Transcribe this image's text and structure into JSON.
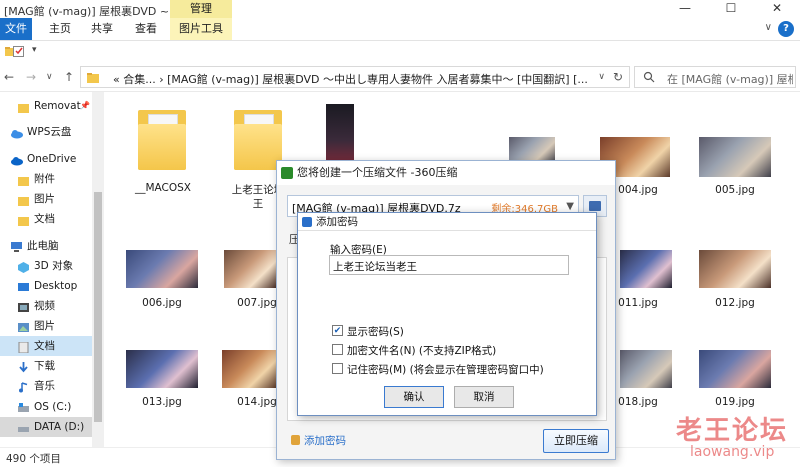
{
  "window": {
    "title": "[MAG館 (v-mag)] 屋根裏DVD ~...",
    "manage_tab": "管理",
    "minimize": "—",
    "maximize": "☐",
    "close": "✕"
  },
  "ribbon": {
    "tabs": [
      "文件",
      "主页",
      "共享",
      "查看",
      "图片工具"
    ],
    "help": "?"
  },
  "nav": {
    "back": "←",
    "forward": "→",
    "recent": "∨",
    "up": "↑",
    "address": "«  合集...  ›  [MAG館 (v-mag)] 屋根裏DVD ～中出し専用人妻物件 入居者募集中～ [中国翻訳] [...",
    "address_chevron": "∨",
    "refresh": "↻",
    "search_placeholder": "在 [MAG館 (v-mag)] 屋根..."
  },
  "sidebar": {
    "items": [
      {
        "label": "Removat",
        "icon": "folder-icon"
      },
      {
        "label": "WPS云盘",
        "icon": "cloud-icon"
      },
      {
        "label": "OneDrive",
        "icon": "cloud-icon"
      },
      {
        "label": "附件",
        "icon": "folder-icon"
      },
      {
        "label": "图片",
        "icon": "folder-icon"
      },
      {
        "label": "文档",
        "icon": "folder-icon"
      },
      {
        "label": "此电脑",
        "icon": "computer-icon"
      },
      {
        "label": "3D 对象",
        "icon": "cube-icon"
      },
      {
        "label": "Desktop",
        "icon": "desktop-icon"
      },
      {
        "label": "视频",
        "icon": "video-icon"
      },
      {
        "label": "图片",
        "icon": "picture-icon"
      },
      {
        "label": "文档",
        "icon": "document-icon"
      },
      {
        "label": "下载",
        "icon": "download-icon"
      },
      {
        "label": "音乐",
        "icon": "music-icon"
      },
      {
        "label": "OS (C:)",
        "icon": "drive-icon"
      },
      {
        "label": "DATA (D:)",
        "icon": "drive-icon"
      }
    ]
  },
  "files": [
    {
      "name": "__MACOSX",
      "type": "folder"
    },
    {
      "name": "上老王论坛",
      "name2": "王",
      "type": "folder"
    },
    {
      "name": "",
      "type": "image"
    },
    {
      "name": "004.jpg",
      "type": "image"
    },
    {
      "name": "005.jpg",
      "type": "image"
    },
    {
      "name": "006.jpg",
      "type": "image"
    },
    {
      "name": "007.jpg",
      "type": "image"
    },
    {
      "name": "011.jpg",
      "type": "image"
    },
    {
      "name": "012.jpg",
      "type": "image"
    },
    {
      "name": "013.jpg",
      "type": "image"
    },
    {
      "name": "014.jpg",
      "type": "image"
    },
    {
      "name": "018.jpg",
      "type": "image"
    },
    {
      "name": "019.jpg",
      "type": "image"
    }
  ],
  "status": {
    "count": "490 个项目"
  },
  "dialog360": {
    "title": "您将创建一个压缩文件 -360压缩",
    "archive_name": "[MAG館 (v-mag)] 屋根裏DVD.7z",
    "free_space": "剩余:346.7GB",
    "side_tab": "压",
    "add_password_link": "添加密码",
    "compress_button": "立即压缩"
  },
  "password_dialog": {
    "title": "添加密码",
    "input_label": "输入密码(E)",
    "password_value": "上老王论坛当老王",
    "options": [
      {
        "label": "显示密码(S)",
        "checked": true
      },
      {
        "label": "加密文件名(N) (不支持ZIP格式)",
        "checked": false
      },
      {
        "label": "记住密码(M) (将会显示在管理密码窗口中)",
        "checked": false
      }
    ],
    "ok_button": "确认",
    "cancel_button": "取消"
  },
  "watermark": {
    "line1": "老王论坛",
    "line2": "laowang.vip"
  },
  "colors": {
    "accent": "#1a6fc9",
    "manage_tab": "#f6eb9c",
    "watermark": "#dc2828"
  }
}
